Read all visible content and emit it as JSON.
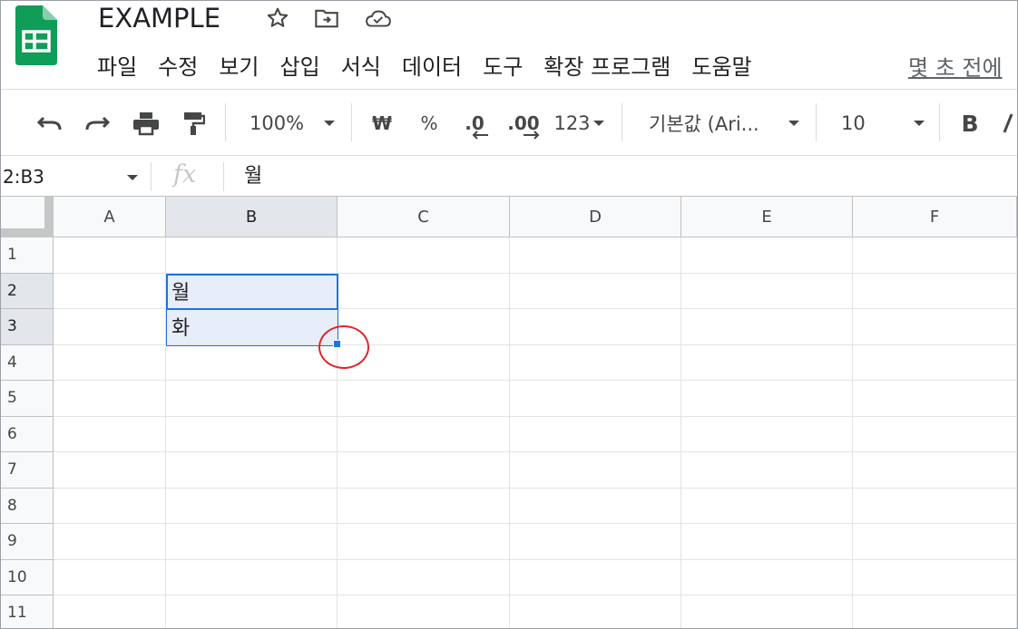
{
  "doc": {
    "title": "EXAMPLE",
    "star_icon": "star-icon",
    "move_icon": "move-to-folder-icon",
    "cloud_icon": "cloud-saved-icon",
    "logo_icon": "google-sheets-logo"
  },
  "menu": {
    "items": [
      "파일",
      "수정",
      "보기",
      "삽입",
      "서식",
      "데이터",
      "도구",
      "확장 프로그램",
      "도움말"
    ],
    "last_edit": "몇 초 전에"
  },
  "toolbar": {
    "zoom": "100%",
    "currency": "₩",
    "percent": "%",
    "decrease_decimal": ".0",
    "increase_decimal": ".00",
    "number_format": "123",
    "font": "기본값 (Ari...",
    "font_size": "10",
    "bold": "B"
  },
  "formula_bar": {
    "name_box": "2:B3",
    "fx": "fx",
    "value": "월"
  },
  "sheet": {
    "columns": [
      "A",
      "B",
      "C",
      "D",
      "E",
      "F"
    ],
    "rows": [
      "1",
      "2",
      "3",
      "4",
      "5",
      "6",
      "7",
      "8",
      "9",
      "10",
      "11"
    ],
    "cells": {
      "B2": "월",
      "B3": "화"
    },
    "selected_range": "B2:B3",
    "active_cell": "B2"
  },
  "colors": {
    "selection": "#1a73e8",
    "selection_fill": "#e8eef9",
    "annotation": "#e0262b",
    "sheets_green": "#0f9d58"
  }
}
